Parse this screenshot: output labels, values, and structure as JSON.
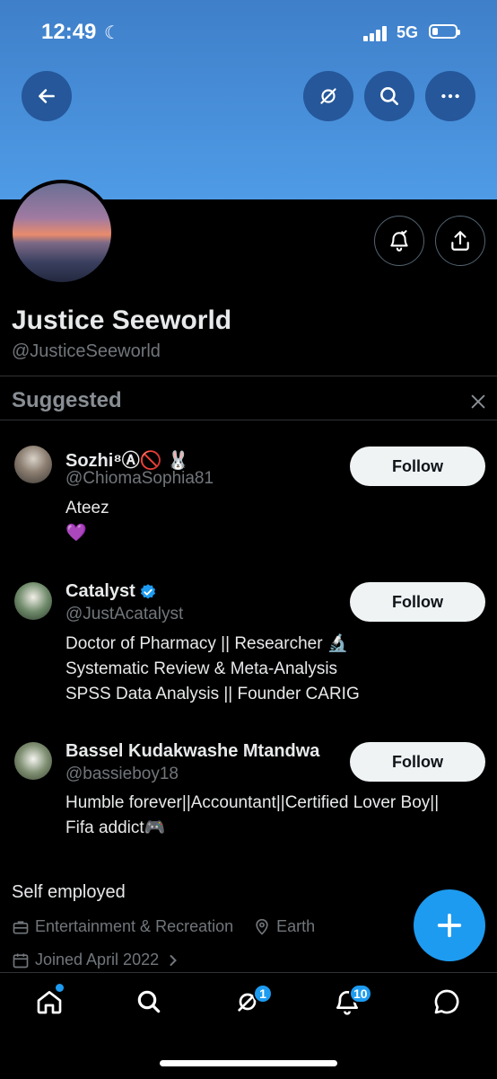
{
  "status": {
    "time": "12:49",
    "network": "5G"
  },
  "profile": {
    "name": "Justice Seeworld",
    "handle": "@JusticeSeeworld",
    "bio": "Self employed",
    "category": "Entertainment & Recreation",
    "location": "Earth",
    "joined": "Joined April 2022"
  },
  "suggested": {
    "title": "Suggested",
    "follow_label": "Follow",
    "items": [
      {
        "name": "Sozhi⁸Ⓐ🚫 🐰",
        "handle": "@ChiomaSophia81",
        "bio": "Ateez\n💜",
        "verified": false
      },
      {
        "name": "Catalyst",
        "handle": "@JustAcatalyst",
        "bio": "Doctor of Pharmacy || Researcher 🔬\nSystematic Review & Meta-Analysis\nSPSS Data Analysis || Founder CARIG",
        "verified": true
      },
      {
        "name": "Bassel Kudakwashe Mtandwa",
        "handle": "@bassieboy18",
        "bio": "Humble forever||Accountant||Certified Lover Boy||\nFifa addict🎮",
        "verified": false
      }
    ]
  },
  "tabbar": {
    "communities_badge": "1",
    "notifications_badge": "10"
  },
  "colors": {
    "accent": "#1d9bf0",
    "banner": "#4f9be6"
  },
  "icons": {
    "back": "arrow-left-icon",
    "grok": "grok-icon",
    "search": "search-icon",
    "more": "more-icon",
    "notify": "bell-plus-icon",
    "share": "share-icon",
    "close": "close-icon"
  }
}
